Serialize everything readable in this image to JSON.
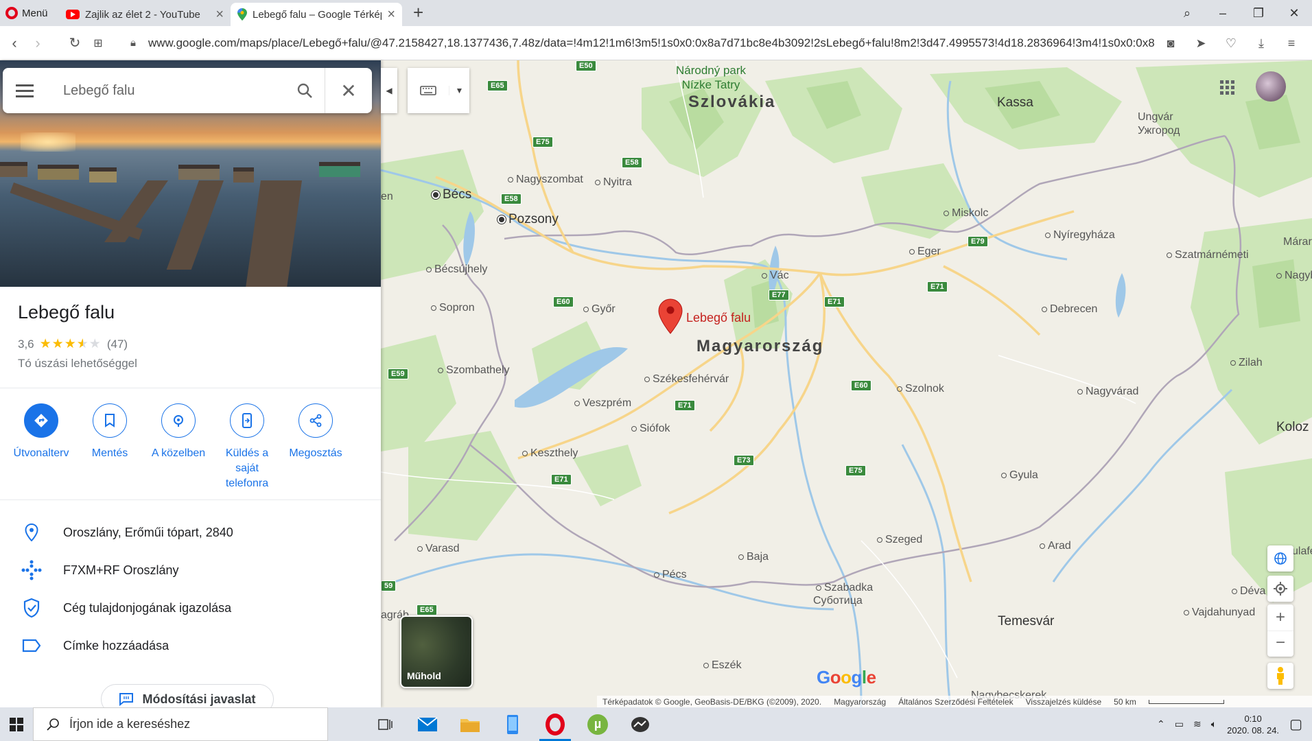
{
  "browser": {
    "menu_label": "Menü",
    "tabs": [
      {
        "title": "Zajlik az élet 2 - YouTube"
      },
      {
        "title": "Lebegő falu – Google Térkép"
      }
    ],
    "url": "www.google.com/maps/place/Lebegő+falu/@47.2158427,18.1377436,7.48z/data=!4m12!1m6!3m5!1s0x0:0x8a7d71bc8e4b3092!2sLebegő+falu!8m2!3d47.4995573!4d18.2836964!3m4!1s0x0:0x8"
  },
  "search": {
    "query": "Lebegő falu"
  },
  "place": {
    "name": "Lebegő falu",
    "rating": "3,6",
    "rating_value": 3.6,
    "review_count": "(47)",
    "category": "Tó úszási lehetőséggel"
  },
  "actions": [
    {
      "label": "Útvonalterv"
    },
    {
      "label": "Mentés"
    },
    {
      "label": "A közelben"
    },
    {
      "label": "Küldés a saját telefonra"
    },
    {
      "label": "Megosztás"
    }
  ],
  "info": {
    "address": "Oroszlány, Erőműi tópart, 2840",
    "plus_code": "F7XM+RF Oroszlány",
    "claim": "Cég tulajdonjogának igazolása",
    "label": "Címke hozzáadása",
    "suggest": "Módosítási javaslat"
  },
  "map": {
    "pin_label": "Lebegő falu",
    "countries": [
      "Szlovákia",
      "Magyarország"
    ],
    "park": [
      "Národný park",
      "Nízke Tatry"
    ],
    "cities": [
      "Kassa",
      "Ungvár",
      "Ужгород",
      "Bécs",
      "Pozsony",
      "Nagyszombat",
      "Nyitra",
      "Miskolc",
      "Nyíregyháza",
      "Szatmárnémeti",
      "Eger",
      "Vác",
      "Bécsújhely",
      "Sopron",
      "Győr",
      "Debrecen",
      "Szombathely",
      "Székesfehérvár",
      "Szolnok",
      "Veszprém",
      "Nagyvárad",
      "Siófok",
      "Keszthely",
      "Gyula",
      "Szeged",
      "Arad",
      "Varasd",
      "Baja",
      "Pécs",
      "Szabadka",
      "Суботица",
      "Déva",
      "Temesvár",
      "Vajdahunyad",
      "Eszék",
      "Zilah",
      "Márar",
      "Nagybán",
      "Koloz",
      "Nagybecskerek",
      "ulafe",
      "en",
      "agráb"
    ],
    "roads": [
      "E50",
      "E65",
      "E75",
      "E58",
      "E58",
      "E79",
      "E77",
      "E71",
      "E71",
      "E60",
      "E59",
      "E71",
      "E60",
      "E73",
      "E75",
      "E71",
      "E65",
      "59"
    ],
    "satellite_label": "Műhold",
    "google": "Google",
    "attribution": {
      "data": "Térképadatok © Google, GeoBasis-DE/BKG (©2009), 2020.",
      "country": "Magyarország",
      "terms": "Általános Szerződési Feltételek",
      "feedback": "Visszajelzés küldése",
      "scale": "50 km"
    }
  },
  "taskbar": {
    "search_placeholder": "Írjon ide a kereséshez",
    "time": "0:10",
    "date": "2020. 08. 24."
  },
  "colors": {
    "accent": "#1a73e8",
    "pin": "#ea4335",
    "highway": "#f9d57a",
    "forest": "#c9e4b4",
    "water": "#9fc8e8"
  }
}
